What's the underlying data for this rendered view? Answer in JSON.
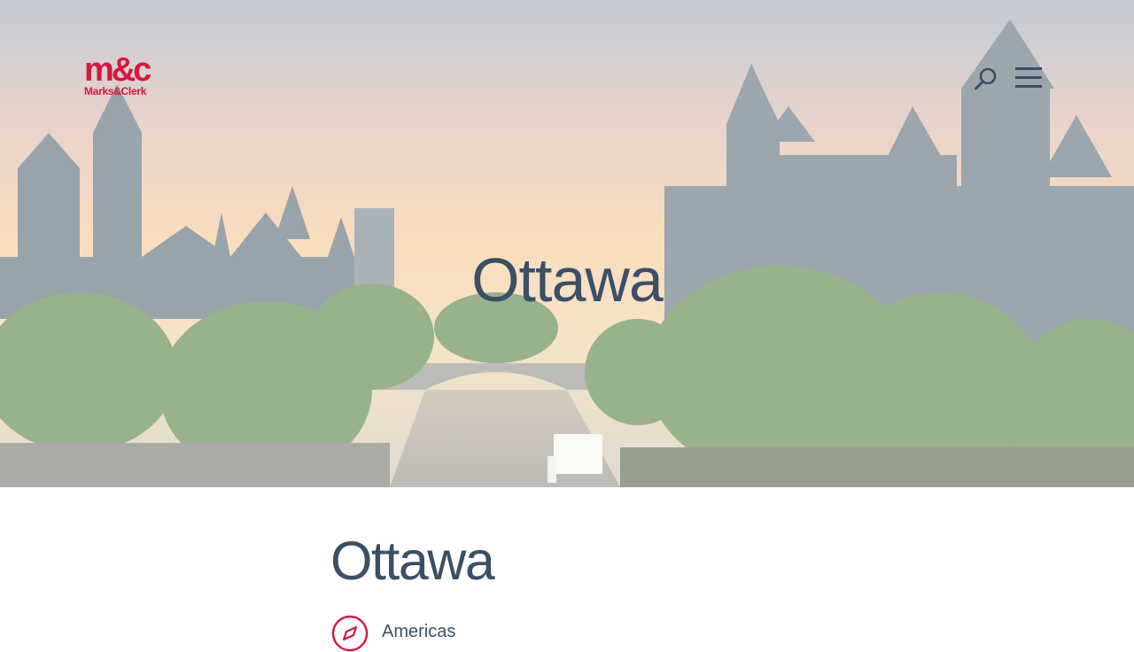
{
  "brand": {
    "logo_mark": "m&c",
    "logo_text": "Marks&Clerk",
    "color": "#d6173f"
  },
  "header": {
    "search_icon": "search-icon",
    "menu_icon": "hamburger-menu-icon"
  },
  "hero": {
    "title": "Ottawa"
  },
  "content": {
    "title": "Ottawa",
    "region": {
      "icon": "compass-icon",
      "label": "Americas"
    }
  },
  "colors": {
    "text": "#3b4f66",
    "accent": "#d6173f"
  }
}
